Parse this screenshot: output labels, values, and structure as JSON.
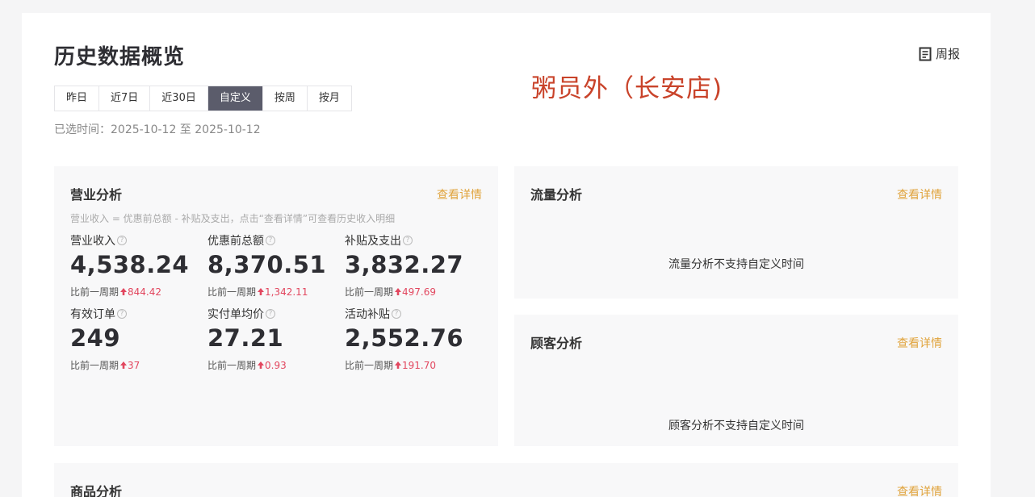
{
  "header": {
    "title": "历史数据概览",
    "weekly_label": "周报",
    "store_name": "粥员外（长安店)"
  },
  "tabs": [
    {
      "label": "昨日",
      "active": false
    },
    {
      "label": "近7日",
      "active": false
    },
    {
      "label": "近30日",
      "active": false
    },
    {
      "label": "自定义",
      "active": true
    },
    {
      "label": "按周",
      "active": false
    },
    {
      "label": "按月",
      "active": false
    }
  ],
  "selected_time": "已选时间：2025-10-12 至 2025-10-12",
  "business": {
    "title": "营业分析",
    "link": "查看详情",
    "note": "营业收入 = 优惠前总额 - 补贴及支出，点击“查看详情”可查看历史收入明细",
    "metrics": [
      {
        "label": "营业收入",
        "value": "4,538.24",
        "compare": "比前一周期",
        "delta": "844.42"
      },
      {
        "label": "优惠前总额",
        "value": "8,370.51",
        "compare": "比前一周期",
        "delta": "1,342.11"
      },
      {
        "label": "补贴及支出",
        "value": "3,832.27",
        "compare": "比前一周期",
        "delta": "497.69"
      },
      {
        "label": "有效订单",
        "value": "249",
        "compare": "比前一周期",
        "delta": "37"
      },
      {
        "label": "实付单均价",
        "value": "27.21",
        "compare": "比前一周期",
        "delta": "0.93"
      },
      {
        "label": "活动补贴",
        "value": "2,552.76",
        "compare": "比前一周期",
        "delta": "191.70"
      }
    ]
  },
  "traffic": {
    "title": "流量分析",
    "link": "查看详情",
    "empty": "流量分析不支持自定义时间"
  },
  "customer": {
    "title": "顾客分析",
    "link": "查看详情",
    "empty": "顾客分析不支持自定义时间"
  },
  "product": {
    "title": "商品分析",
    "link": "查看详情"
  },
  "colors": {
    "accent_link": "#e0a33c",
    "active_tab": "#5b5c6b",
    "store_name": "#c9432a",
    "delta_up": "#e2475f"
  }
}
